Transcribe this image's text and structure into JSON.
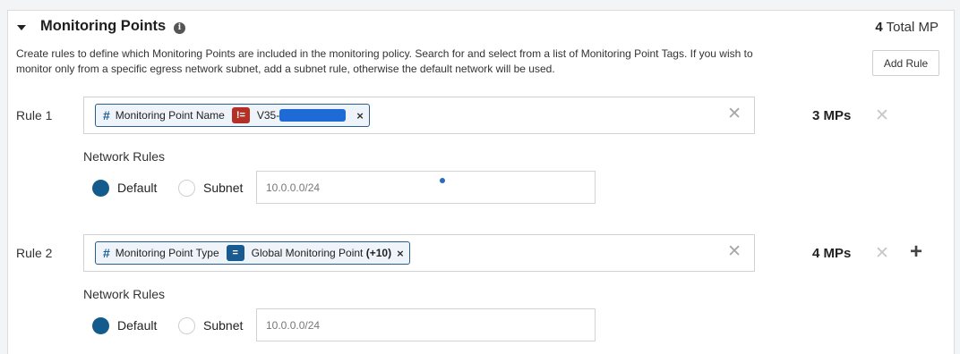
{
  "section": {
    "title": "Monitoring Points",
    "info_icon": "i",
    "total_count": "4",
    "total_label": "Total MP",
    "description": "Create rules to define which Monitoring Points are included in the monitoring policy. Search for and select from a list of Monitoring Point Tags. If you wish to monitor only from a specific egress network subnet, add a subnet rule, otherwise the default network will be used.",
    "add_rule_label": "Add Rule"
  },
  "rules": [
    {
      "label": "Rule 1",
      "chip": {
        "hash": "#",
        "field": "Monitoring Point Name",
        "operator": "!=",
        "value": "V35-",
        "value_redacted": true,
        "remove": "×"
      },
      "clear": "✕",
      "mp_count": "3 MPs",
      "delete": "✕",
      "network_rules_label": "Network Rules",
      "default_label": "Default",
      "subnet_label": "Subnet",
      "subnet_placeholder": "10.0.0.0/24",
      "selected": "Default"
    },
    {
      "label": "Rule 2",
      "chip": {
        "hash": "#",
        "field": "Monitoring Point Type",
        "operator": "=",
        "value": "Global Monitoring Point",
        "extra": "(+10)",
        "remove": "×"
      },
      "clear": "✕",
      "mp_count": "4 MPs",
      "delete": "✕",
      "add": "+",
      "network_rules_label": "Network Rules",
      "default_label": "Default",
      "subnet_label": "Subnet",
      "subnet_placeholder": "10.0.0.0/24",
      "selected": "Default"
    }
  ],
  "colors": {
    "accent": "#125b8c",
    "operator_not_equal": "#b43026",
    "operator_equal": "#195b90",
    "redaction": "#1f6bd6"
  },
  "icons": {
    "collapse": "caret-down-icon",
    "info": "info-circle-icon",
    "tag": "hash-icon",
    "clear": "close-icon",
    "add": "plus-icon"
  }
}
